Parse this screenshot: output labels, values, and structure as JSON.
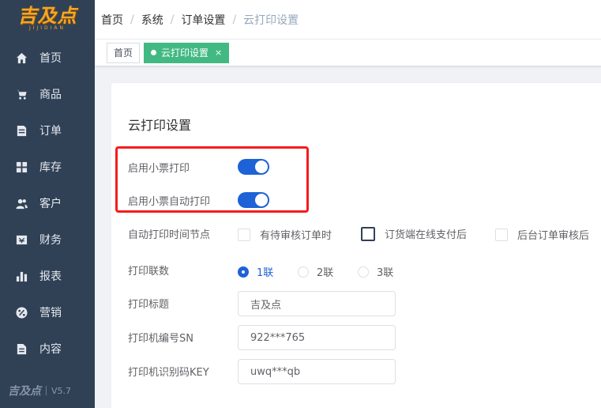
{
  "logo": {
    "main": "吉及点",
    "sub": "JIJIDIAN"
  },
  "sidebar": {
    "items": [
      {
        "label": "首页",
        "icon": "home-icon"
      },
      {
        "label": "商品",
        "icon": "cart-icon"
      },
      {
        "label": "订单",
        "icon": "order-icon"
      },
      {
        "label": "库存",
        "icon": "grid-icon"
      },
      {
        "label": "客户",
        "icon": "users-icon"
      },
      {
        "label": "财务",
        "icon": "finance-icon"
      },
      {
        "label": "报表",
        "icon": "bar-chart-icon"
      },
      {
        "label": "营销",
        "icon": "percent-icon"
      },
      {
        "label": "内容",
        "icon": "document-icon"
      }
    ],
    "footer_logo": "吉及点",
    "version": "V5.7"
  },
  "breadcrumb": {
    "items": [
      "首页",
      "系统",
      "订单设置",
      "云打印设置"
    ],
    "separator": "/"
  },
  "tags": {
    "home": "首页",
    "active": "云打印设置",
    "close": "×"
  },
  "form": {
    "title": "云打印设置",
    "enable_receipt_label": "启用小票打印",
    "enable_receipt_on": true,
    "enable_auto_label": "启用小票自动打印",
    "enable_auto_on": true,
    "time_node_label": "自动打印时间节点",
    "time_node_options": [
      "有待审核订单时",
      "订货端在线支付后",
      "后台订单审核后"
    ],
    "copies_label": "打印联数",
    "copies_options": [
      "1联",
      "2联",
      "3联"
    ],
    "copies_selected": "1联",
    "print_title_label": "打印标题",
    "print_title_value": "吉及点",
    "sn_label": "打印机编号SN",
    "sn_value": "922***765",
    "key_label": "打印机识别码KEY",
    "key_value": "uwq***qb"
  },
  "colors": {
    "sidebar_bg": "#304156",
    "accent_blue": "#1d62d6",
    "tag_green": "#42b983",
    "highlight_red": "#f51c1c"
  }
}
